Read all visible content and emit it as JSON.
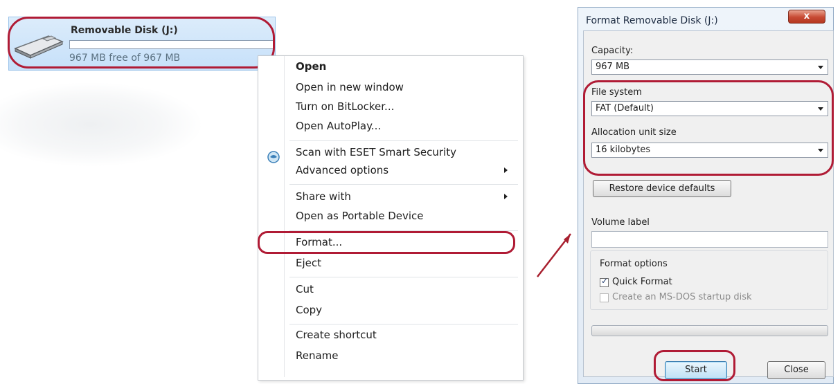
{
  "drive": {
    "name": "Removable Disk (J:)",
    "free_text": "967 MB free of 967 MB",
    "used_fraction": 0.0
  },
  "context_menu": {
    "items": [
      {
        "label": "Open"
      },
      {
        "label": "Open in new window"
      },
      {
        "label": "Turn on BitLocker..."
      },
      {
        "label": "Open AutoPlay..."
      },
      {
        "label": "Scan with ESET Smart Security"
      },
      {
        "label": "Advanced options"
      },
      {
        "label": "Share with"
      },
      {
        "label": "Open as Portable Device"
      },
      {
        "label": "Format..."
      },
      {
        "label": "Eject"
      },
      {
        "label": "Cut"
      },
      {
        "label": "Copy"
      },
      {
        "label": "Create shortcut"
      },
      {
        "label": "Rename"
      }
    ]
  },
  "format_dialog": {
    "title": "Format Removable Disk (J:)",
    "close_label": "x",
    "capacity_label": "Capacity:",
    "capacity_value": "967 MB",
    "file_system_label": "File system",
    "file_system_value": "FAT (Default)",
    "allocation_label": "Allocation unit size",
    "allocation_value": "16 kilobytes",
    "restore_label": "Restore device defaults",
    "volume_label": "Volume label",
    "volume_value": "",
    "format_options_label": "Format options",
    "quick_format_label": "Quick Format",
    "quick_format_checked": true,
    "msdos_label": "Create an MS-DOS startup disk",
    "msdos_checked": false,
    "start_label": "Start",
    "close_button_label": "Close"
  },
  "colors": {
    "highlight": "#b01b35",
    "selection": "#c6e0f9",
    "dialog_frame": "#e2ebf5"
  }
}
